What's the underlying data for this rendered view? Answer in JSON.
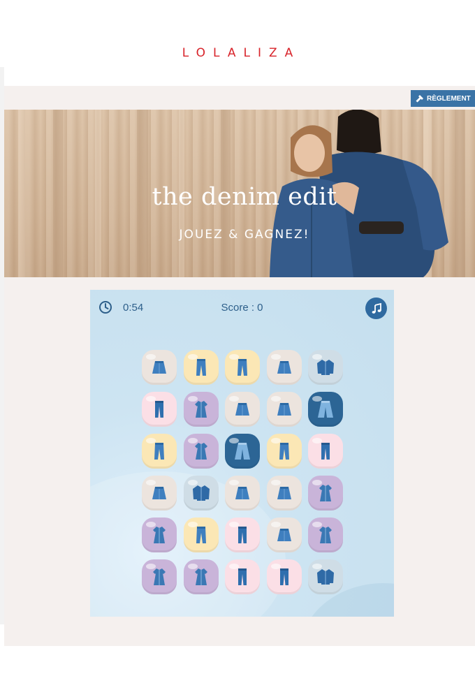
{
  "brand": "LOLALIZA",
  "rules_button": "RÈGLEMENT",
  "hero": {
    "title": "the denim edit",
    "subtitle": "JOUEZ & GAGNEZ!"
  },
  "game": {
    "timer": "0:54",
    "score": "Score : 0",
    "icons": {
      "timer": "clock-icon",
      "music": "music-note-icon",
      "rules": "hammer-icon"
    },
    "board": [
      [
        {
          "item": "skirt",
          "bg": "beige"
        },
        {
          "item": "jeans",
          "bg": "yellow"
        },
        {
          "item": "jeans",
          "bg": "yellow"
        },
        {
          "item": "skirt",
          "bg": "beige"
        },
        {
          "item": "jacket",
          "bg": "gray"
        }
      ],
      [
        {
          "item": "straight-jeans",
          "bg": "pink"
        },
        {
          "item": "dress",
          "bg": "purple"
        },
        {
          "item": "skirt",
          "bg": "beige"
        },
        {
          "item": "skirt",
          "bg": "beige"
        },
        {
          "item": "wide-jeans",
          "bg": "navy"
        }
      ],
      [
        {
          "item": "jeans",
          "bg": "yellow"
        },
        {
          "item": "dress",
          "bg": "purple"
        },
        {
          "item": "wide-jeans",
          "bg": "navy"
        },
        {
          "item": "jeans",
          "bg": "yellow"
        },
        {
          "item": "straight-jeans",
          "bg": "pink"
        }
      ],
      [
        {
          "item": "skirt",
          "bg": "beige"
        },
        {
          "item": "jacket",
          "bg": "gray"
        },
        {
          "item": "skirt",
          "bg": "beige"
        },
        {
          "item": "skirt",
          "bg": "beige"
        },
        {
          "item": "dress",
          "bg": "purple"
        }
      ],
      [
        {
          "item": "dress",
          "bg": "purple"
        },
        {
          "item": "jeans",
          "bg": "yellow"
        },
        {
          "item": "straight-jeans",
          "bg": "pink"
        },
        {
          "item": "skirt",
          "bg": "beige"
        },
        {
          "item": "dress",
          "bg": "purple"
        }
      ],
      [
        {
          "item": "dress",
          "bg": "purple"
        },
        {
          "item": "dress",
          "bg": "purple"
        },
        {
          "item": "straight-jeans",
          "bg": "pink"
        },
        {
          "item": "straight-jeans",
          "bg": "pink"
        },
        {
          "item": "jacket",
          "bg": "gray"
        }
      ]
    ]
  },
  "colors": {
    "brand_red": "#d8232a",
    "accent_blue": "#2f6aa0",
    "denim": "#3a78b4"
  }
}
